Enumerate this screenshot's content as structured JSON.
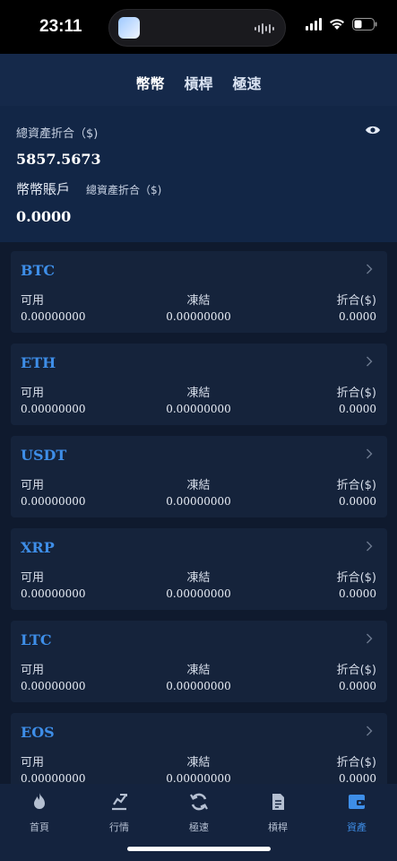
{
  "status_bar": {
    "time": "23:11"
  },
  "header": {
    "tabs": [
      "幣幣",
      "槓桿",
      "極速"
    ]
  },
  "summary": {
    "total_label": "總資產折合（$)",
    "total_value": "5857.5673",
    "account_label": "幣幣賬戶",
    "account_sub_label": "總資產折合（$)",
    "account_value": "0.0000"
  },
  "assets": [
    {
      "coin": "BTC",
      "available_label": "可用",
      "frozen_label": "凍結",
      "converted_label": "折合($)",
      "available": "0.00000000",
      "frozen": "0.00000000",
      "converted": "0.0000"
    },
    {
      "coin": "ETH",
      "available_label": "可用",
      "frozen_label": "凍結",
      "converted_label": "折合($)",
      "available": "0.00000000",
      "frozen": "0.00000000",
      "converted": "0.0000"
    },
    {
      "coin": "USDT",
      "available_label": "可用",
      "frozen_label": "凍結",
      "converted_label": "折合($)",
      "available": "0.00000000",
      "frozen": "0.00000000",
      "converted": "0.0000"
    },
    {
      "coin": "XRP",
      "available_label": "可用",
      "frozen_label": "凍結",
      "converted_label": "折合($)",
      "available": "0.00000000",
      "frozen": "0.00000000",
      "converted": "0.0000"
    },
    {
      "coin": "LTC",
      "available_label": "可用",
      "frozen_label": "凍結",
      "converted_label": "折合($)",
      "available": "0.00000000",
      "frozen": "0.00000000",
      "converted": "0.0000"
    },
    {
      "coin": "EOS",
      "available_label": "可用",
      "frozen_label": "凍結",
      "converted_label": "折合($)",
      "available": "0.00000000",
      "frozen": "0.00000000",
      "converted": "0.0000"
    }
  ],
  "bottom_nav": [
    {
      "label": "首頁",
      "icon": "flame-icon"
    },
    {
      "label": "行情",
      "icon": "chart-icon"
    },
    {
      "label": "極速",
      "icon": "refresh-icon"
    },
    {
      "label": "槓桿",
      "icon": "document-icon"
    },
    {
      "label": "資產",
      "icon": "wallet-icon"
    }
  ],
  "colors": {
    "accent": "#3e8ee8",
    "background": "#0f1a2e",
    "card": "#15233b"
  }
}
